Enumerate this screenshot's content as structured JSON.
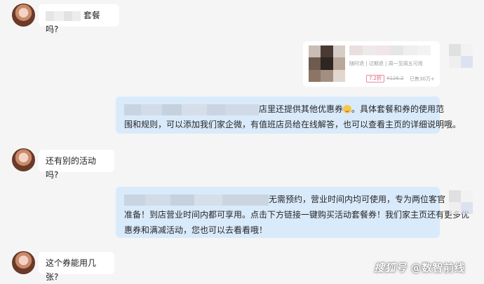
{
  "messages": [
    {
      "id": "m1",
      "from": "customer",
      "text": "套餐吗?"
    },
    {
      "id": "card",
      "from": "shop",
      "product_card": {
        "meta": "随时退 | 过期退 | 周一至周五可用",
        "discount": "7.2折",
        "original_price": "¥126.2",
        "sold": "已售30万+"
      }
    },
    {
      "id": "m2",
      "from": "shop",
      "text": "店里还提供其他优惠券😉。具体套餐和券的使用范围和规则，可以添加我们家企微，有值班店员给在线解答，也可以查看主页的详细说明哦。"
    },
    {
      "id": "m3",
      "from": "customer",
      "text": "还有别的活动吗?"
    },
    {
      "id": "m4",
      "from": "shop",
      "text": "无需预约，营业时间内均可使用，专为两位客官准备！到店营业时间内都可享用。点击下方链接一键购买活动套餐券！我们家主页还有更多优惠券和满减活动，您也可以去看看哦！"
    },
    {
      "id": "m5",
      "from": "customer",
      "text": "这个券能用几张?"
    }
  ],
  "m2_line1": "店里还提供其他优惠券",
  "m2_line1_rest": "。具体套餐和券的使用范",
  "m2_line2": "围和规则，可以添加我们家企微，有值班店员给在线解答，也可以查看主页的详细说明哦。",
  "m4_line1": "无需预约，营业时间内均可使用，专为两位客官",
  "m4_line2": "准备！到店营业时间内都可享用。点击下方链接一键购买活动套餐券！我们家主页还有更多优",
  "m4_line3": "惠券和满减活动，您也可以去看看哦！",
  "watermark": {
    "logo": "搜狐号",
    "text": "@数智前线"
  },
  "colors": {
    "page_bg": "#f5f5f6",
    "incoming_bubble": "#ffffff",
    "outgoing_bubble": "#d9eafb",
    "discount": "#e05a7c"
  }
}
